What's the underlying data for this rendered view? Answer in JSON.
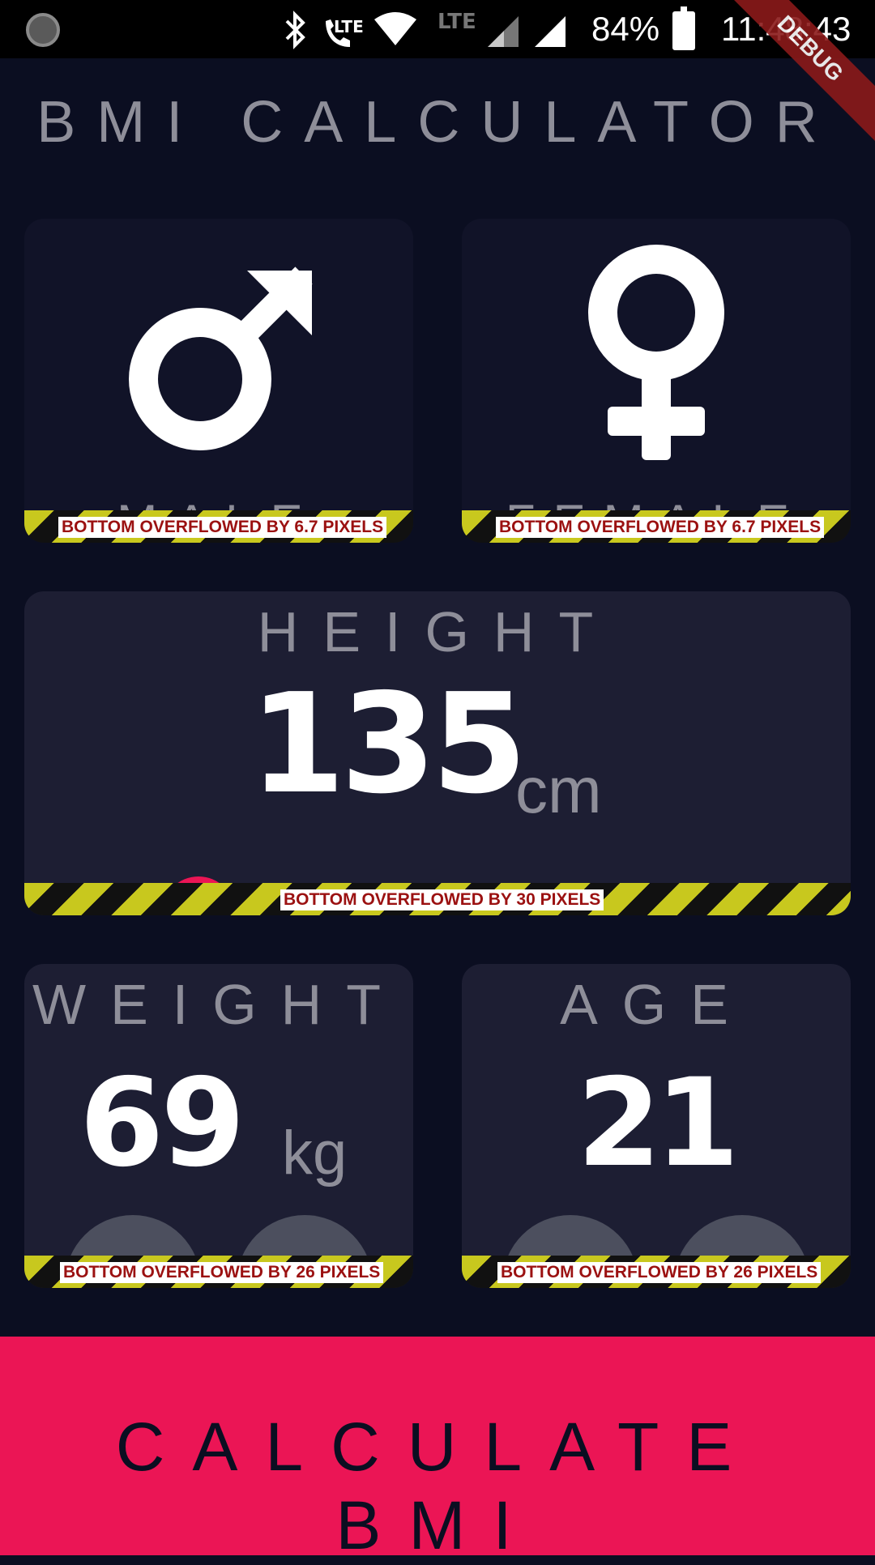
{
  "status_bar": {
    "lte_call_tag": "LTE",
    "lte_secondary": "LTE",
    "battery_percent": "84%",
    "time": "11:48:43",
    "debug_ribbon": "DEBUG"
  },
  "app": {
    "title": "BMI CALCULATOR",
    "accent_color": "#eb1555",
    "active_card_color": "#1d1e33",
    "inactive_card_color": "#111328",
    "background_color": "#0b0e21"
  },
  "gender": {
    "male": {
      "label": "MALE",
      "icon": "male-symbol-icon",
      "overflow": "BOTTOM OVERFLOWED BY 6.7 PIXELS"
    },
    "female": {
      "label": "FEMALE",
      "icon": "female-symbol-icon",
      "overflow": "BOTTOM OVERFLOWED BY 6.7 PIXELS"
    }
  },
  "height": {
    "label": "HEIGHT",
    "value": "135",
    "unit": "cm",
    "overflow": "BOTTOM OVERFLOWED BY 30 PIXELS"
  },
  "weight": {
    "label": "WEIGHT",
    "value": "69",
    "unit": "kg",
    "overflow": "BOTTOM OVERFLOWED BY 26 PIXELS"
  },
  "age": {
    "label": "AGE",
    "value": "21",
    "overflow": "BOTTOM OVERFLOWED BY 26 PIXELS"
  },
  "calculate_button": {
    "label": "CALCULATE BMI"
  }
}
